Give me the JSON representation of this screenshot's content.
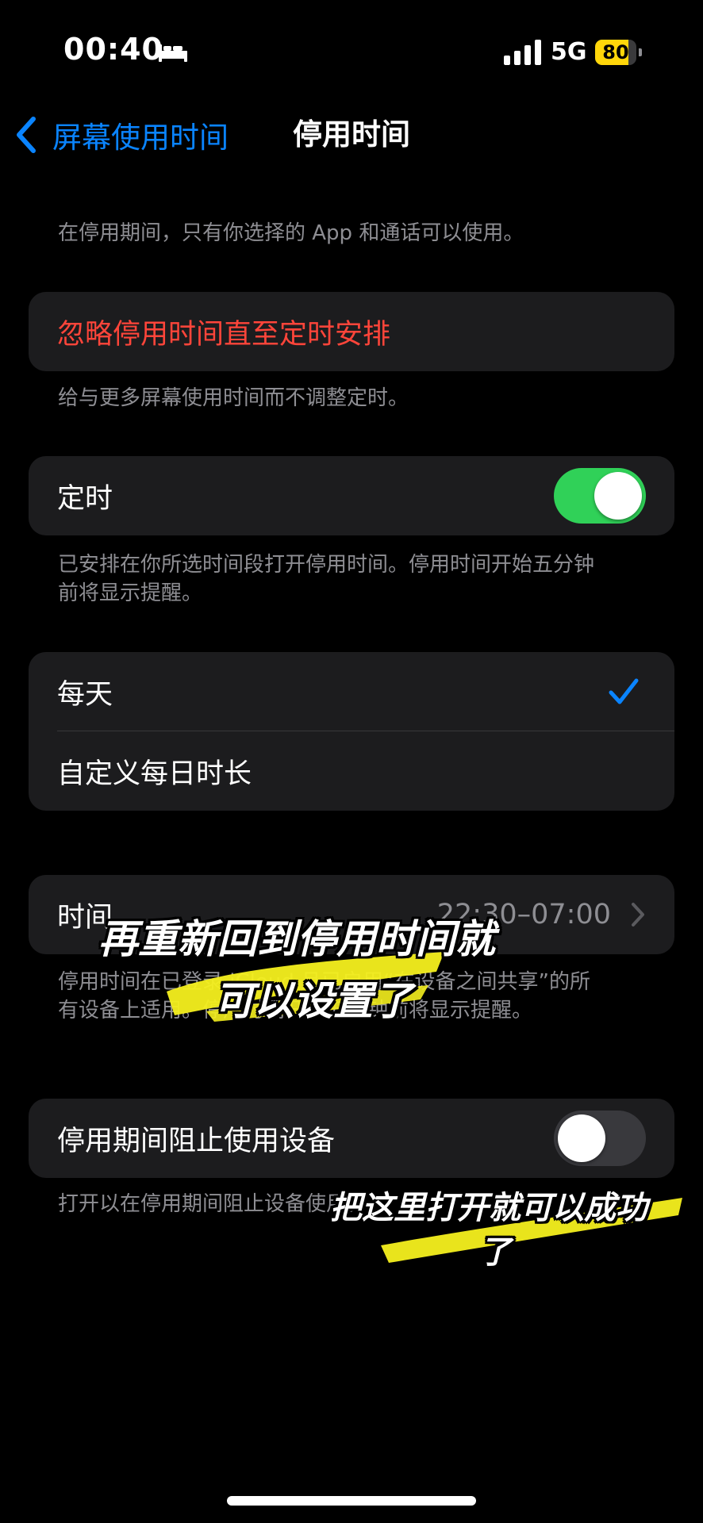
{
  "status_bar": {
    "time": "00:40",
    "sleep_icon": "bed-icon",
    "network": "5G",
    "battery_level": "80",
    "battery_fraction": 0.8,
    "battery_color": "#ffd60a"
  },
  "nav": {
    "back_label": "屏幕使用时间",
    "title": "停用时间",
    "accent_color": "#0a84ff"
  },
  "intro_text": "在停用期间，只有你选择的 App 和通话可以使用。",
  "ignore_section": {
    "label": "忽略停用时间直至定时安排",
    "footnote": "给与更多屏幕使用时间而不调整定时。",
    "color": "#ff453a"
  },
  "schedule_section": {
    "label": "定时",
    "enabled": true,
    "footnote": "已安排在你所选时间段打开停用时间。停用时间开始五分钟前将显示提醒。",
    "toggle_color": "#30d158"
  },
  "frequency_section": {
    "options": [
      {
        "label": "每天",
        "selected": true
      },
      {
        "label": "自定义每日时长",
        "selected": false
      }
    ]
  },
  "time_section": {
    "label": "时间",
    "value": "22:30–07:00",
    "footnote": "停用时间在已登录 iCloud 且已启用“在设备之间共享”的所有设备上适用。停用时间开始五分钟前将显示提醒。"
  },
  "block_section": {
    "label": "停用期间阻止使用设备",
    "enabled": false,
    "footnote": "打开以在停用期间阻止设备使用。"
  },
  "overlay": {
    "caption1_line1": "再重新回到停用时间就",
    "caption1_line2": "可以设置了",
    "caption2_line1": "把这里打开就可以成功",
    "caption2_line2": "了",
    "highlight_color": "#f5f01e"
  }
}
